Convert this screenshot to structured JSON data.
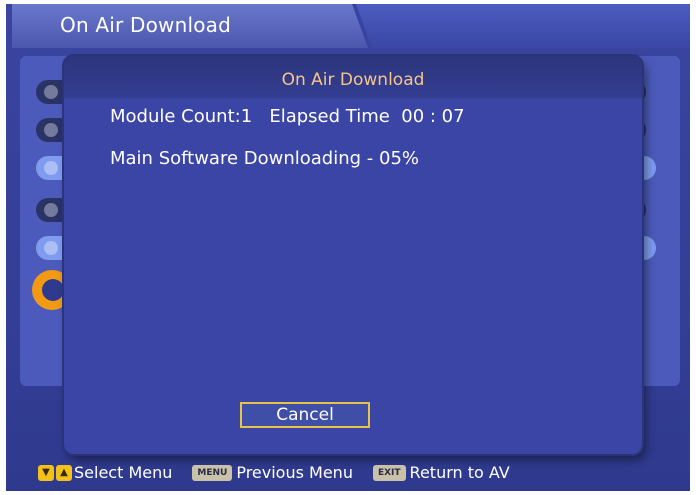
{
  "header": {
    "title": "On Air Download"
  },
  "dialog": {
    "title": "On Air Download",
    "module_count": "Module Count:1",
    "elapsed_label": "Elapsed Time",
    "elapsed_value": "00 : 07",
    "status": "Main Software Downloading - 05%",
    "progress_percent": 5,
    "cancel_label": "Cancel"
  },
  "footer": {
    "keys": [
      {
        "icon": "up-down-arrow-keys-icon",
        "tag": "",
        "label": "Select Menu"
      },
      {
        "icon": "menu-key-icon",
        "tag": "MENU",
        "label": "Previous Menu"
      },
      {
        "icon": "exit-key-icon",
        "tag": "EXIT",
        "label": "Return to AV"
      }
    ]
  },
  "colors": {
    "background": "#2f3a8e",
    "dialog": "#3a45a5",
    "dialog_title": "#f6c58a",
    "accent_orange": "#f29a13",
    "button_border": "#e7c348"
  }
}
